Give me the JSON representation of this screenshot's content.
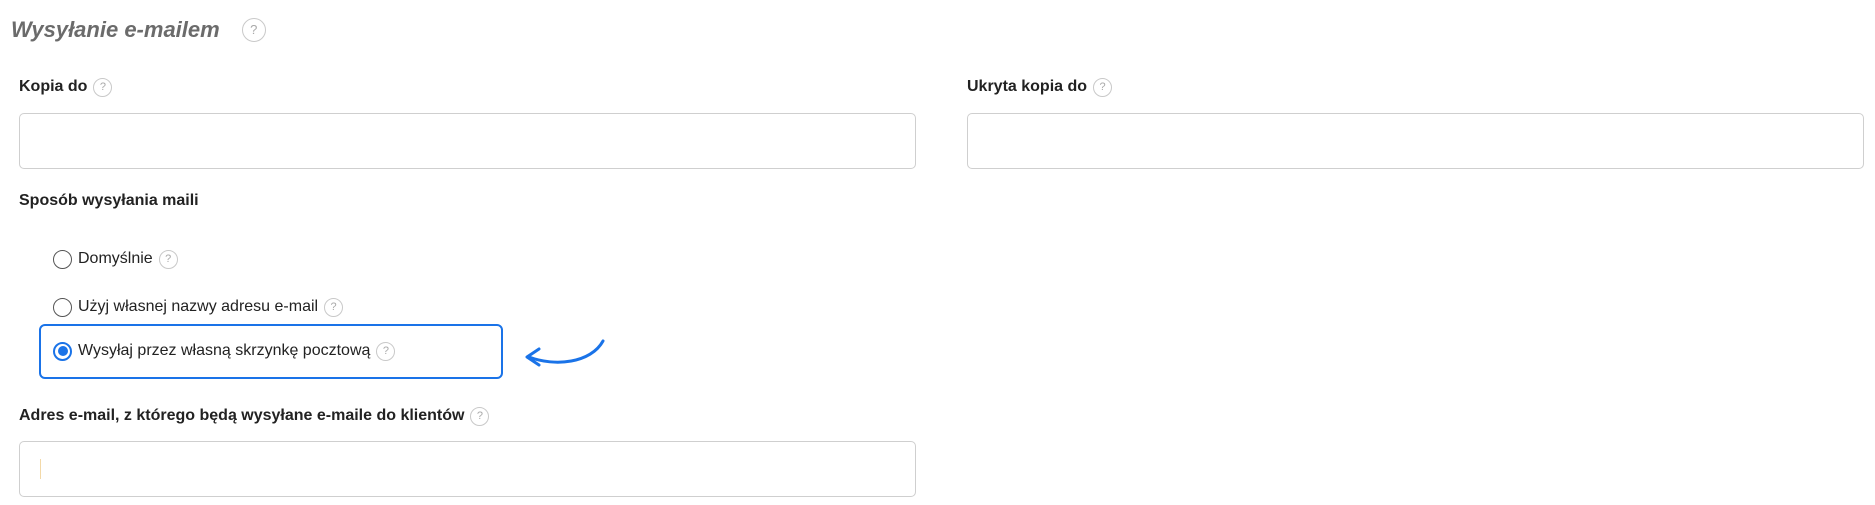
{
  "section": {
    "title": "Wysyłanie e-mailem",
    "help": "?"
  },
  "cc": {
    "label": "Kopia do",
    "help": "?",
    "value": "",
    "placeholder": ""
  },
  "bcc": {
    "label": "Ukryta kopia do",
    "help": "?",
    "value": "",
    "placeholder": ""
  },
  "send_method": {
    "label": "Sposób wysyłania maili",
    "options": [
      {
        "label": "Domyślnie",
        "help": "?",
        "checked": false
      },
      {
        "label": "Użyj własnej nazwy adresu e-mail",
        "help": "?",
        "checked": false
      },
      {
        "label": "Wysyłaj przez własną skrzynkę pocztową",
        "help": "?",
        "checked": true
      }
    ]
  },
  "sender_email": {
    "label": "Adres e-mail, z którego będą wysyłane e-maile do klientów",
    "help": "?",
    "value": "",
    "placeholder": ""
  },
  "colors": {
    "accent": "#1a73e8",
    "title_gray": "#6b6b6b",
    "border": "#cfcfcf"
  },
  "icons": {
    "help": "question-circle-icon",
    "annotation": "curved-arrow-icon"
  }
}
